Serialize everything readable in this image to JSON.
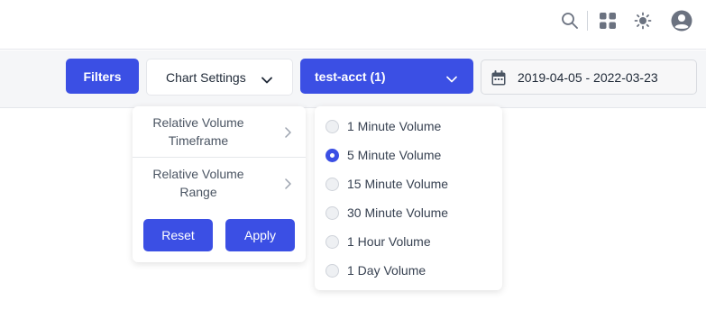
{
  "header": {
    "icons": [
      "search-icon",
      "apps-grid-icon",
      "brightness-icon",
      "user-account-icon"
    ]
  },
  "toolbar": {
    "filters_label": "Filters",
    "chart_settings_label": "Chart Settings",
    "account_label": "test-acct (1)",
    "date_range": "2019-04-05 - 2022-03-23"
  },
  "chart_settings_menu": {
    "items": [
      {
        "label": "Relative Volume Timeframe"
      },
      {
        "label": "Relative Volume Range"
      }
    ],
    "reset_label": "Reset",
    "apply_label": "Apply"
  },
  "volume_options": {
    "items": [
      {
        "label": "1 Minute Volume",
        "checked": false
      },
      {
        "label": "5 Minute Volume",
        "checked": true
      },
      {
        "label": "15 Minute Volume",
        "checked": false
      },
      {
        "label": "30 Minute Volume",
        "checked": false
      },
      {
        "label": "1 Hour Volume",
        "checked": false
      },
      {
        "label": "1 Day Volume",
        "checked": false
      }
    ]
  },
  "colors": {
    "accent": "#3b4fe4",
    "toolbar_bg": "#f5f6f8"
  }
}
